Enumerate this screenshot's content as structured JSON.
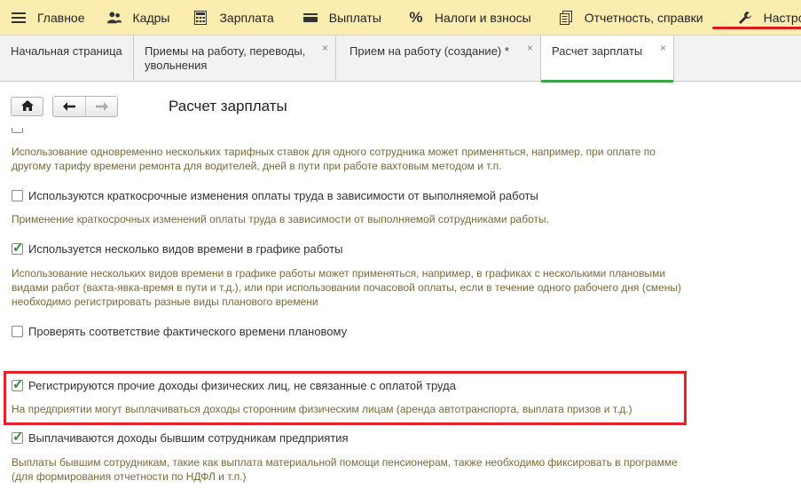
{
  "menu": {
    "items": [
      {
        "icon": "hamburger-icon",
        "label": "Главное"
      },
      {
        "icon": "people-icon",
        "label": "Кадры"
      },
      {
        "icon": "calculator-icon",
        "label": "Зарплата"
      },
      {
        "icon": "wallet-icon",
        "label": "Выплаты"
      },
      {
        "icon": "percent-icon",
        "label": "Налоги и взносы"
      },
      {
        "icon": "documents-icon",
        "label": "Отчетность, справки"
      },
      {
        "icon": "wrench-icon",
        "label": "Настройка"
      }
    ],
    "active": "Настройка"
  },
  "tabs": [
    {
      "label": "Начальная страница",
      "closable": false
    },
    {
      "label": "Приемы на работу, переводы, увольнения",
      "closable": true
    },
    {
      "label": "Прием на работу (создание) *",
      "closable": true
    },
    {
      "label": "Расчет зарплаты",
      "closable": true,
      "current": true
    }
  ],
  "tab_close_glyph": "×",
  "toolbar": {
    "home_icon": "home-icon",
    "back_icon": "arrow-left-icon",
    "forward_icon": "arrow-right-icon"
  },
  "page": {
    "title": "Расчет зарплаты"
  },
  "options": [
    {
      "label": "",
      "checked": false,
      "description": "Использование одновременно нескольких тарифных ставок для одного сотрудника может применяться, например, при оплате по другому тарифу времени ремонта для водителей, дней в пути при работе вахтовым методом и т.п."
    },
    {
      "label": "Используются краткосрочные изменения оплаты труда в зависимости от выполняемой работы",
      "checked": false,
      "description": "Применение краткосрочных изменений оплаты труда в зависимости от выполняемой сотрудниками работы."
    },
    {
      "label": "Используется несколько видов времени в графике работы",
      "checked": true,
      "description": "Использование нескольких видов времени в графике работы может применяться, например, в графиках с несколькими плановыми видами работ (вахта-явка-время в пути и т.д.), или при использовании почасовой оплаты, если в течение одного рабочего дня (смены) необходимо регистрировать разные виды планового времени"
    },
    {
      "label": "Проверять соответствие фактического времени плановому",
      "checked": false,
      "description": ""
    },
    {
      "label": "Регистрируются прочие доходы физических лиц, не связанные с оплатой труда",
      "checked": true,
      "description": "На предприятии могут выплачиваться доходы сторонним физическим лицам (аренда автотранспорта, выплата призов и т.д.)"
    },
    {
      "label": "Выплачиваются доходы бывшим сотрудникам предприятия",
      "checked": true,
      "description": "Выплаты бывшим сотрудникам, такие как выплата материальной помощи пенсионерам, также необходимо фиксировать в программе (для формирования отчетности по НДФЛ и т.п.)"
    }
  ],
  "colors": {
    "menu_bg": "#fbedb0",
    "active_underline": "#e01b1b",
    "current_tab_underline": "#3aa64a",
    "highlight_box": "#e8202a",
    "description_text": "#7a6a3a",
    "checkmark": "#2e8b2e"
  }
}
